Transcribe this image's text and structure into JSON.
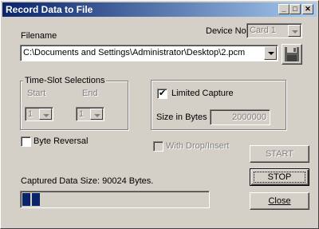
{
  "window": {
    "title": "Record Data to File"
  },
  "titlebar_buttons": {
    "minimize": "_",
    "maximize": "□",
    "close": "✕"
  },
  "filename": {
    "label": "Filename",
    "value": "C:\\Documents and Settings\\Administrator\\Desktop\\2.pcm"
  },
  "device": {
    "label": "Device No",
    "value": "Card 1"
  },
  "timeslot": {
    "legend": "Time-Slot Selections",
    "start_label": "Start",
    "end_label": "End",
    "start_value": "1",
    "end_value": "1"
  },
  "limited_capture": {
    "label": "Limited Capture",
    "checked": true,
    "size_label": "Size in Bytes",
    "size_value": "2000000"
  },
  "byte_reversal": {
    "label": "Byte Reversal",
    "checked": false
  },
  "drop_insert": {
    "label": "With Drop/Insert",
    "checked": false
  },
  "status": {
    "captured": "Captured Data Size: 90024 Bytes."
  },
  "progress": {
    "fraction": 0.09
  },
  "buttons": {
    "start": "START",
    "stop": "STOP",
    "close": "Close"
  },
  "icons": {
    "save": "floppy-disk-icon"
  }
}
